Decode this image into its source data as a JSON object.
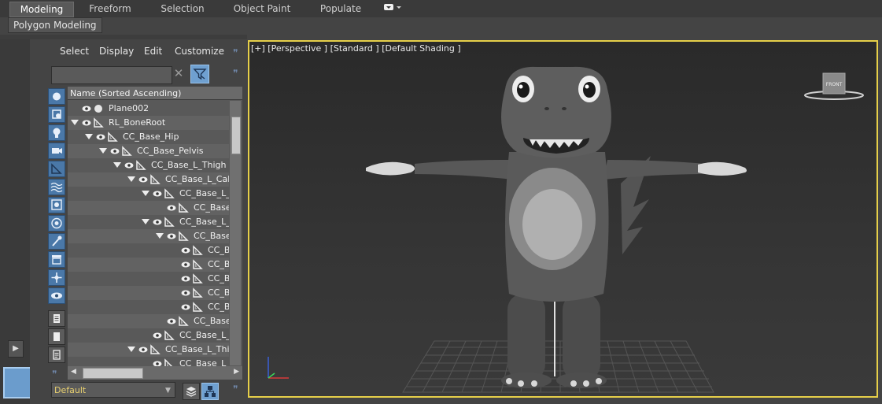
{
  "ribbon": {
    "tabs": [
      {
        "label": "Modeling",
        "active": true
      },
      {
        "label": "Freeform",
        "active": false
      },
      {
        "label": "Selection",
        "active": false
      },
      {
        "label": "Object Paint",
        "active": false
      },
      {
        "label": "Populate",
        "active": false
      }
    ],
    "subtab": "Polygon Modeling"
  },
  "scene_explorer": {
    "menu": [
      "Select",
      "Display",
      "Edit",
      "Customize"
    ],
    "search_value": "",
    "column_header": "Name (Sorted Ascending)",
    "rows": [
      {
        "label": "Plane002",
        "indent": 0,
        "expand": false,
        "icon": "sphere-icon"
      },
      {
        "label": "RL_BoneRoot",
        "indent": 0,
        "expand": true,
        "icon": "bone-icon"
      },
      {
        "label": "CC_Base_Hip",
        "indent": 1,
        "expand": true,
        "icon": "bone-icon"
      },
      {
        "label": "CC_Base_Pelvis",
        "indent": 2,
        "expand": true,
        "icon": "bone-icon"
      },
      {
        "label": "CC_Base_L_Thigh",
        "indent": 3,
        "expand": true,
        "icon": "bone-icon"
      },
      {
        "label": "CC_Base_L_Calf",
        "indent": 4,
        "expand": true,
        "icon": "bone-icon"
      },
      {
        "label": "CC_Base_L_C",
        "indent": 5,
        "expand": true,
        "icon": "bone-icon"
      },
      {
        "label": "CC_Base",
        "indent": 6,
        "expand": false,
        "icon": "bone-icon"
      },
      {
        "label": "CC_Base_L_I",
        "indent": 5,
        "expand": true,
        "icon": "bone-icon"
      },
      {
        "label": "CC_Base",
        "indent": 6,
        "expand": true,
        "icon": "bone-icon"
      },
      {
        "label": "CC_B",
        "indent": 7,
        "expand": false,
        "icon": "bone-icon"
      },
      {
        "label": "CC_B",
        "indent": 7,
        "expand": false,
        "icon": "bone-icon"
      },
      {
        "label": "CC_B",
        "indent": 7,
        "expand": false,
        "icon": "bone-icon"
      },
      {
        "label": "CC_B",
        "indent": 7,
        "expand": false,
        "icon": "bone-icon"
      },
      {
        "label": "CC_B",
        "indent": 7,
        "expand": false,
        "icon": "bone-icon"
      },
      {
        "label": "CC_Base",
        "indent": 6,
        "expand": false,
        "icon": "bone-icon"
      },
      {
        "label": "CC_Base_L_I",
        "indent": 5,
        "expand": false,
        "icon": "bone-icon"
      },
      {
        "label": "CC_Base_L_Thig",
        "indent": 4,
        "expand": true,
        "icon": "bone-icon"
      },
      {
        "label": "CC_Base_L_",
        "indent": 5,
        "expand": false,
        "icon": "bone-icon"
      }
    ],
    "layer": "Default"
  },
  "viewport": {
    "label": "[+] [Perspective ] [Standard ] [Default Shading ]",
    "viewcube_face": "FRONT",
    "border_color": "#e6cf49"
  },
  "colors": {
    "accent_blue": "#6fa0d0",
    "layer_text": "#e8d070"
  }
}
